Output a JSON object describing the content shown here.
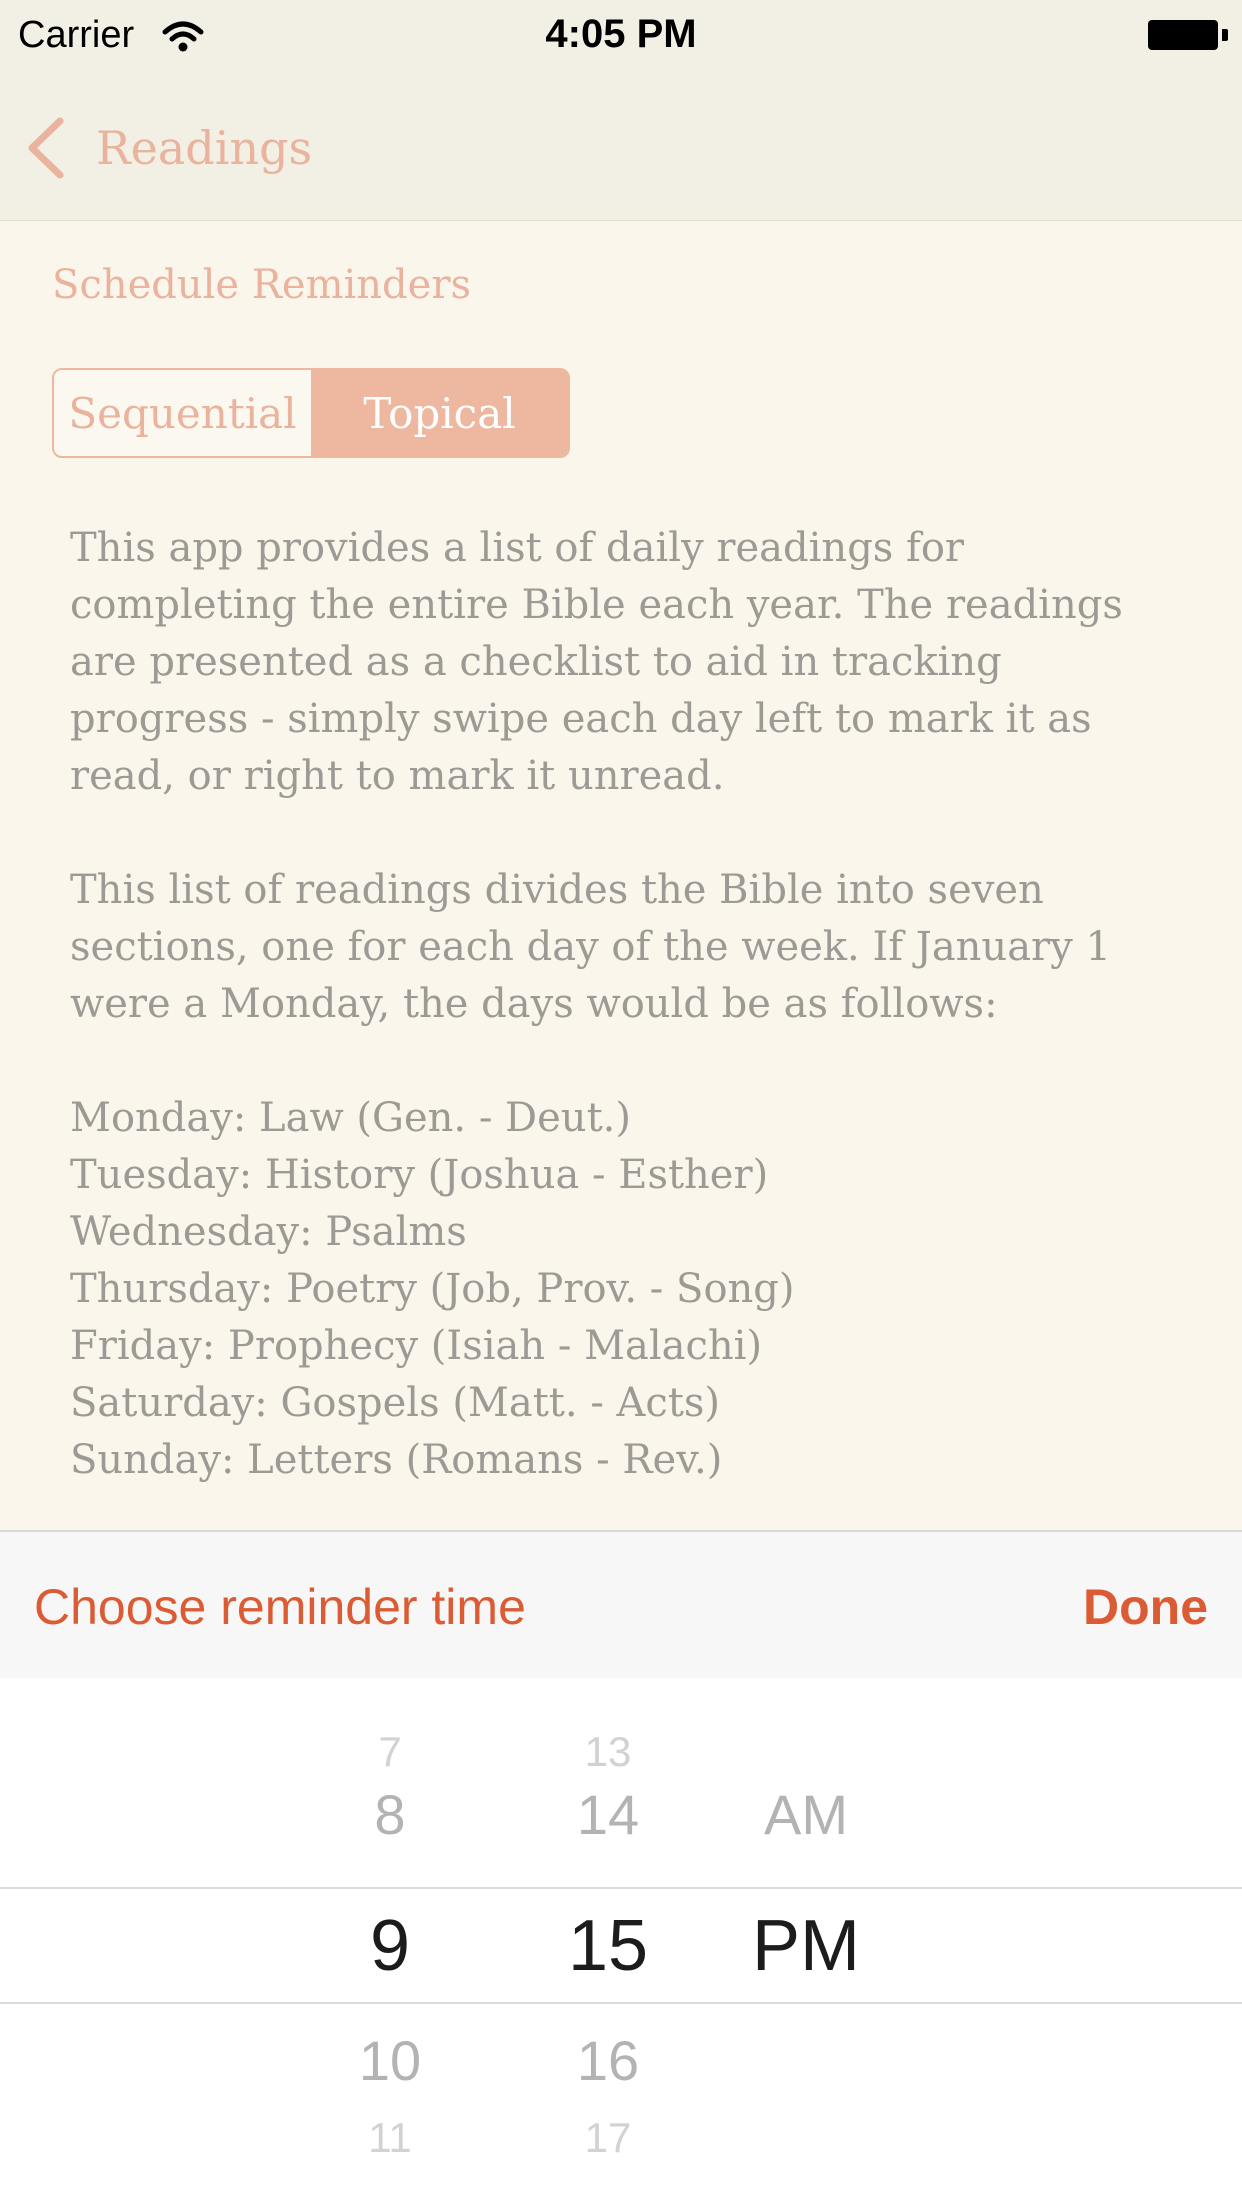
{
  "status_bar": {
    "carrier": "Carrier",
    "time": "4:05 PM"
  },
  "nav": {
    "back_label": "Readings"
  },
  "content": {
    "section_title": "Schedule Reminders",
    "segments": [
      "Sequential",
      "Topical"
    ],
    "selected_segment": "Topical",
    "paragraph1": "This app provides a list of daily readings for completing the entire Bible each year. The readings are presented as a checklist to aid in tracking progress - simply swipe each day left to mark it as read, or right to mark it unread.",
    "paragraph2": "This list of readings divides the Bible into seven sections, one for each day of the week. If January 1 were a Monday, the days would be as follows:",
    "days": [
      "Monday: Law (Gen. - Deut.)",
      "Tuesday: History (Joshua - Esther)",
      "Wednesday: Psalms",
      "Thursday: Poetry (Job, Prov. - Song)",
      "Friday: Prophecy (Isiah - Malachi)",
      "Saturday: Gospels (Matt. - Acts)",
      "Sunday: Letters (Romans - Rev.)"
    ]
  },
  "toolbar": {
    "title": "Choose reminder time",
    "done_label": "Done"
  },
  "picker": {
    "hours": [
      "7",
      "8",
      "9",
      "10",
      "11"
    ],
    "minutes": [
      "13",
      "14",
      "15",
      "16",
      "17"
    ],
    "periods": [
      "AM",
      "PM"
    ],
    "selected": {
      "hour": "9",
      "minute": "15",
      "period": "PM"
    }
  },
  "colors": {
    "accent": "#db5c34",
    "muted_accent": "#eab39d",
    "background": "#faf6ec",
    "body_text": "#9d9994"
  }
}
